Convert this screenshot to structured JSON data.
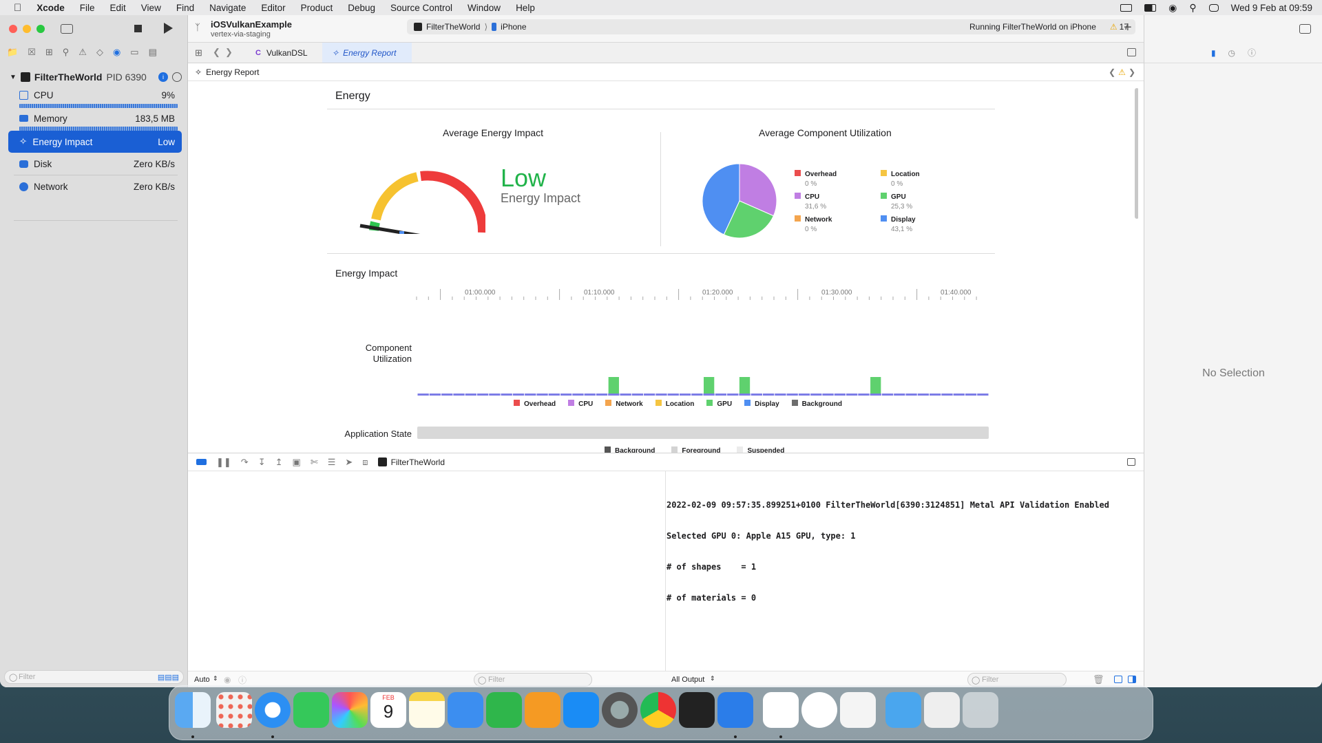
{
  "menubar": {
    "app": "Xcode",
    "items": [
      "File",
      "Edit",
      "View",
      "Find",
      "Navigate",
      "Editor",
      "Product",
      "Debug",
      "Source Control",
      "Window",
      "Help"
    ],
    "clock": "Wed 9 Feb at 09:59"
  },
  "toolbar": {
    "project": "iOSVulkanExample",
    "branch": "vertex-via-staging",
    "scheme": "FilterTheWorld",
    "device": "iPhone",
    "status": "Running FilterTheWorld on iPhone",
    "warnings": "17"
  },
  "tabs": [
    {
      "label": "VulkanDSL"
    },
    {
      "label": "Energy Report"
    }
  ],
  "jumpbar": {
    "label": "Energy Report"
  },
  "navigator": {
    "process": "FilterTheWorld",
    "pid": "PID 6390",
    "gauges": [
      {
        "label": "CPU",
        "value": "9%"
      },
      {
        "label": "Memory",
        "value": "183,5 MB"
      },
      {
        "label": "Energy Impact",
        "value": "Low"
      },
      {
        "label": "Disk",
        "value": "Zero KB/s"
      },
      {
        "label": "Network",
        "value": "Zero KB/s"
      }
    ],
    "filter_placeholder": "Filter"
  },
  "report": {
    "title": "Energy",
    "avg_energy_title": "Average Energy Impact",
    "energy_level": "Low",
    "energy_level_sub": "Energy Impact",
    "avg_component_title": "Average Component Utilization",
    "components": [
      {
        "name": "Overhead",
        "value": "0 %",
        "color": "#eb4d4d"
      },
      {
        "name": "Location",
        "value": "0 %",
        "color": "#f5c542"
      },
      {
        "name": "CPU",
        "value": "31,6 %",
        "color": "#c07ee3"
      },
      {
        "name": "GPU",
        "value": "25,3 %",
        "color": "#5fd16e"
      },
      {
        "name": "Network",
        "value": "0 %",
        "color": "#f4a54e"
      },
      {
        "name": "Display",
        "value": "43,1 %",
        "color": "#4f8ff2"
      }
    ],
    "impact_title": "Energy Impact",
    "time_ticks": [
      "01:00.000",
      "01:10.000",
      "01:20.000",
      "01:30.000",
      "01:40.000"
    ],
    "component_util_label_1": "Component",
    "component_util_label_2": "Utilization",
    "util_legend": [
      {
        "name": "Overhead",
        "color": "#eb4d4d"
      },
      {
        "name": "CPU",
        "color": "#c07ee3"
      },
      {
        "name": "Network",
        "color": "#f4a54e"
      },
      {
        "name": "Location",
        "color": "#f5c542"
      },
      {
        "name": "GPU",
        "color": "#5fd16e"
      },
      {
        "name": "Display",
        "color": "#4f8ff2"
      },
      {
        "name": "Background",
        "color": "#6d6d6d"
      }
    ],
    "app_state_label": "Application State",
    "state_legend": [
      {
        "name": "Background",
        "color": "#555555"
      },
      {
        "name": "Foreground",
        "color": "#d3d3d3"
      },
      {
        "name": "Suspended",
        "color": "#ebebeb"
      }
    ]
  },
  "chart_data": {
    "type": "pie",
    "title": "Average Component Utilization",
    "categories": [
      "Overhead",
      "Location",
      "CPU",
      "GPU",
      "Network",
      "Display"
    ],
    "values": [
      0,
      0,
      31.6,
      25.3,
      0,
      43.1
    ]
  },
  "debug": {
    "process": "FilterTheWorld",
    "console_lines": [
      "2022-02-09 09:57:35.899251+0100 FilterTheWorld[6390:3124851] Metal API Validation Enabled",
      "Selected GPU 0: Apple A15 GPU, type: 1",
      "# of shapes    = 1",
      "# of materials = 0"
    ],
    "auto_label": "Auto",
    "filter_placeholder": "Filter",
    "output_label": "All Output",
    "filter2_placeholder": "Filter"
  },
  "inspector": {
    "empty": "No Selection"
  },
  "dock": {
    "calendar_month": "FEB",
    "calendar_day": "9"
  }
}
